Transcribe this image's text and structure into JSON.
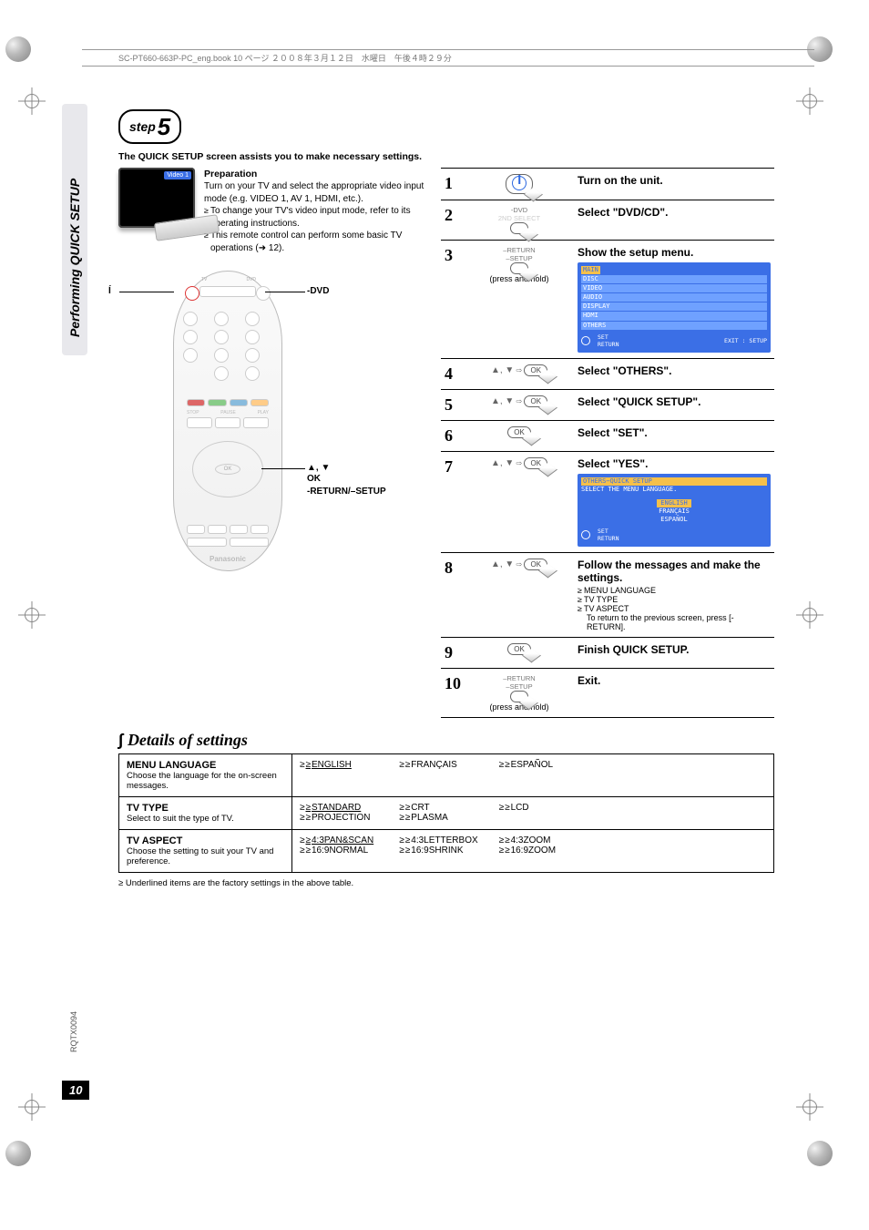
{
  "header_strip": "SC-PT660-663P-PC_eng.book  10 ページ  ２００８年３月１２日　水曜日　午後４時２９分",
  "side_tab": "Performing QUICK SETUP",
  "step_label": "step",
  "step_number": "5",
  "intro": "The QUICK SETUP screen assists you to make necessary settings.",
  "tv_video_label": "Video 1",
  "preparation": {
    "title": "Preparation",
    "body": "Turn on your TV and select the appropriate video input mode (e.g. VIDEO 1, AV 1, HDMI, etc.).",
    "bullet1": "To change your TV's video input mode, refer to its operating instructions.",
    "bullet2": "This remote control can perform some basic TV operations (➜ 12)."
  },
  "remote_labels": {
    "power": "Í",
    "dvd": "-DVD",
    "arrows": "▲, ▼",
    "ok": "OK",
    "return": "-RETURN/–SETUP",
    "brand": "Panasonic"
  },
  "steps": [
    {
      "n": "1",
      "ctrl": "power",
      "title": "Turn on the unit."
    },
    {
      "n": "2",
      "ctrl_label1": "-DVD",
      "ctrl_label2": "2ND SELECT",
      "title": "Select \"DVD/CD\"."
    },
    {
      "n": "3",
      "ctrl_label1": "–RETURN",
      "ctrl_label2": "–SETUP",
      "press_hold": "(press and hold)",
      "title": "Show the setup menu.",
      "osd": {
        "header": "MAIN",
        "items": [
          "DISC",
          "VIDEO",
          "AUDIO",
          "DISPLAY",
          "HDMI",
          "OTHERS"
        ],
        "footer_set": "SET",
        "footer_return": "RETURN",
        "footer_exit": "EXIT : SETUP"
      }
    },
    {
      "n": "4",
      "arrows": "▲, ▼",
      "ok": "OK",
      "title": "Select \"OTHERS\"."
    },
    {
      "n": "5",
      "arrows": "▲, ▼",
      "ok": "OK",
      "title": "Select \"QUICK SETUP\"."
    },
    {
      "n": "6",
      "ok": "OK",
      "title": "Select \"SET\"."
    },
    {
      "n": "7",
      "arrows": "▲, ▼",
      "ok": "OK",
      "title": "Select \"YES\".",
      "osd2": {
        "header": "OTHERS−QUICK  SETUP",
        "sub": "SELECT THE MENU LANGUAGE.",
        "langs": [
          "ENGLISH",
          "FRANÇAIS",
          "ESPAÑOL"
        ],
        "footer_set": "SET",
        "footer_return": "RETURN"
      }
    },
    {
      "n": "8",
      "arrows": "▲, ▼",
      "ok": "OK",
      "title": "Follow the messages and make the settings.",
      "subs": [
        "MENU LANGUAGE",
        "TV TYPE",
        "TV ASPECT"
      ],
      "return_note": "To return to the previous screen, press [-RETURN]."
    },
    {
      "n": "9",
      "ok": "OK",
      "title": "Finish QUICK SETUP."
    },
    {
      "n": "10",
      "ctrl_label1": "–RETURN",
      "ctrl_label2": "–SETUP",
      "press_hold": "(press and hold)",
      "title": "Exit."
    }
  ],
  "details_title": "Details of settings",
  "settings": [
    {
      "name": "MENU LANGUAGE",
      "sub": "Choose the language for the on-screen messages.",
      "cols": [
        [
          "ENGLISH"
        ],
        [
          "FRANÇAIS"
        ],
        [
          "ESPAÑOL"
        ]
      ],
      "underline_first": true
    },
    {
      "name": "TV TYPE",
      "sub": "Select to suit the type of TV.",
      "cols": [
        [
          "STANDARD",
          "PROJECTION"
        ],
        [
          "CRT",
          "PLASMA"
        ],
        [
          "LCD"
        ]
      ],
      "underline_first": true
    },
    {
      "name": "TV ASPECT",
      "sub": "Choose the setting to suit your TV and preference.",
      "cols": [
        [
          "4:3PAN&SCAN",
          "16:9NORMAL"
        ],
        [
          "4:3LETTERBOX",
          "16:9SHRINK"
        ],
        [
          "4:3ZOOM",
          "16:9ZOOM"
        ]
      ],
      "underline_first": true
    }
  ],
  "footnote": "Underlined items are the factory settings in the above table.",
  "doc_code": "RQTX0094",
  "page_number": "10"
}
